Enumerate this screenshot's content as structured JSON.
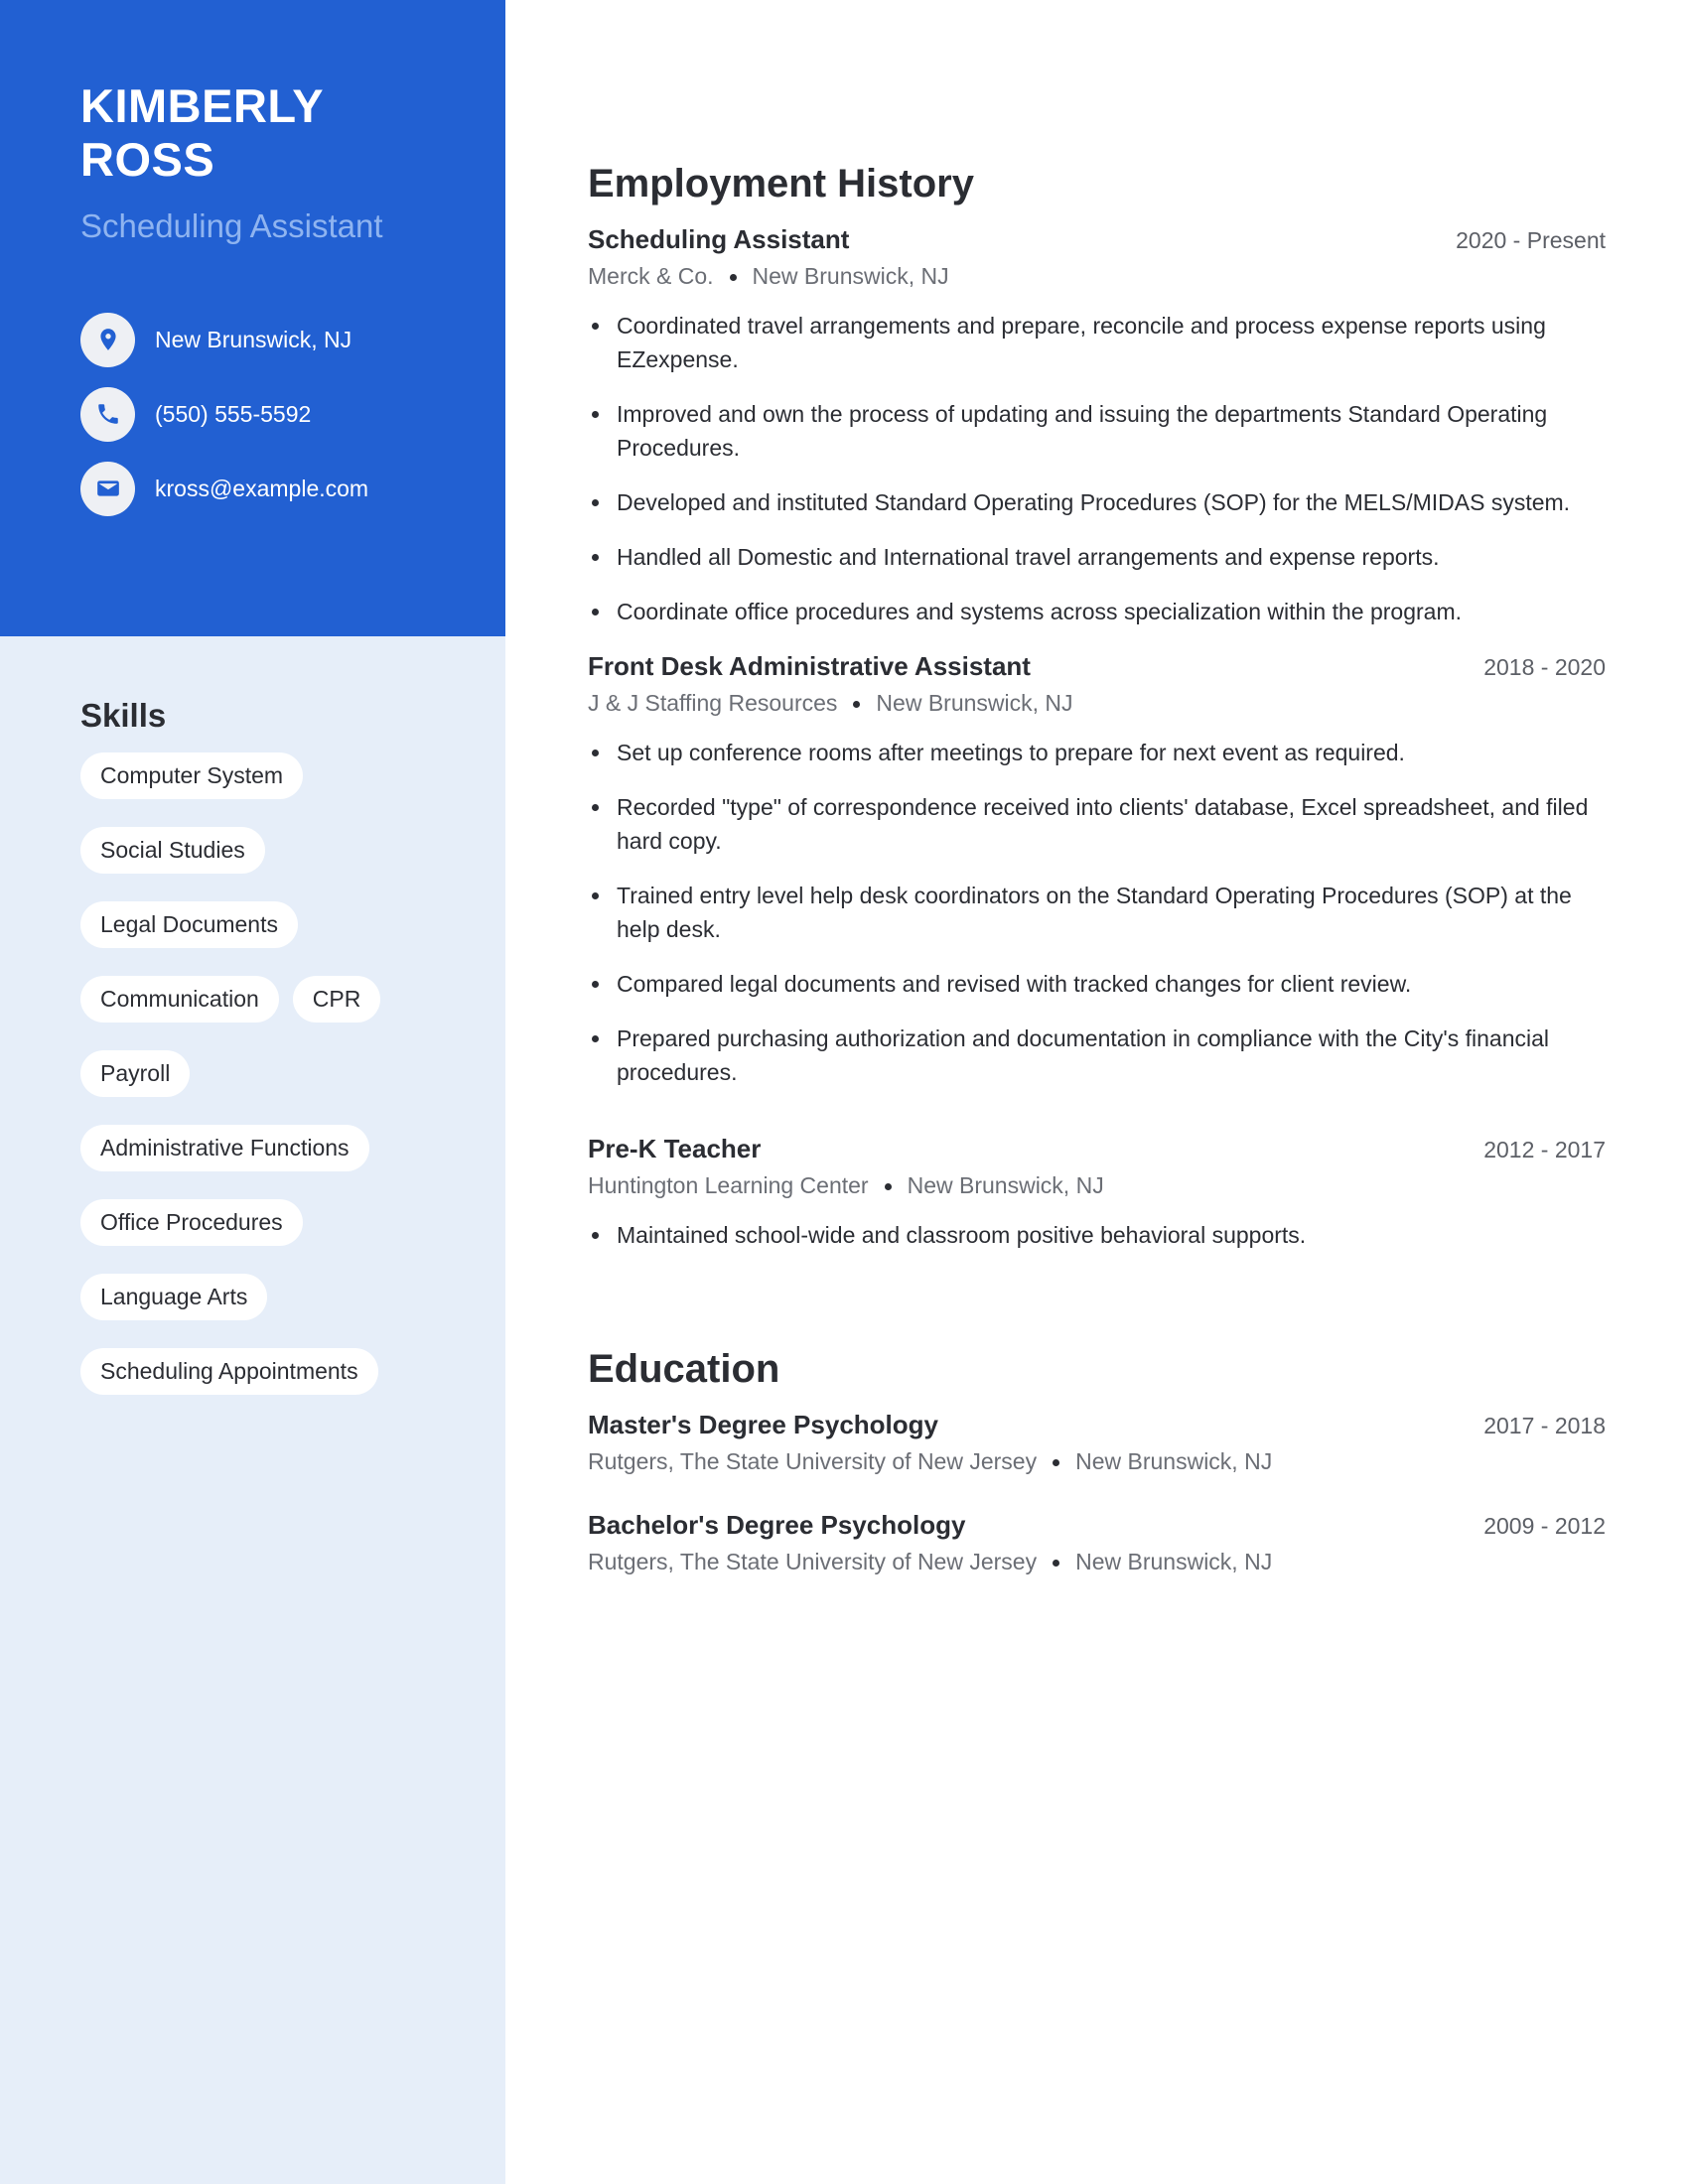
{
  "theme": {
    "accent": "#2260d2",
    "sidebar_bg": "#e6eef9",
    "title_color": "#8fb4f0"
  },
  "header": {
    "name": "KIMBERLY ROSS",
    "title": "Scheduling Assistant"
  },
  "contacts": [
    {
      "icon": "location-pin-icon",
      "text": "New Brunswick, NJ"
    },
    {
      "icon": "phone-icon",
      "text": "(550) 555-5592"
    },
    {
      "icon": "envelope-icon",
      "text": "kross@example.com"
    }
  ],
  "skills": {
    "title": "Skills",
    "items": [
      "Computer System",
      "Social Studies",
      "Legal Documents",
      "Communication",
      "CPR",
      "Payroll",
      "Administrative Functions",
      "Office Procedures",
      "Language Arts",
      "Scheduling Appointments"
    ]
  },
  "employment": {
    "title": "Employment History",
    "jobs": [
      {
        "title": "Scheduling Assistant",
        "dates": "2020 - Present",
        "company": "Merck & Co.",
        "location": "New Brunswick, NJ",
        "bullets": [
          "Coordinated travel arrangements and prepare, reconcile and process expense reports using EZexpense.",
          "Improved and own the process of updating and issuing the departments Standard Operating Procedures.",
          "Developed and instituted Standard Operating Procedures (SOP) for the MELS/MIDAS system.",
          "Handled all Domestic and International travel arrangements and expense reports.",
          "Coordinate office procedures and systems across specialization within the program."
        ]
      },
      {
        "title": "Front Desk Administrative Assistant",
        "dates": "2018 - 2020",
        "company": "J & J Staffing Resources",
        "location": "New Brunswick, NJ",
        "bullets": [
          "Set up conference rooms after meetings to prepare for next event as required.",
          "Recorded \"type\" of correspondence received into clients' database, Excel spreadsheet, and filed hard copy.",
          "Trained entry level help desk coordinators on the Standard Operating Procedures (SOP) at the help desk.",
          "Compared legal documents and revised with tracked changes for client review.",
          "Prepared purchasing authorization and documentation in compliance with the City's financial procedures."
        ]
      },
      {
        "title": "Pre-K Teacher",
        "dates": "2012 - 2017",
        "company": "Huntington Learning Center",
        "location": "New Brunswick, NJ",
        "bullets": [
          "Maintained school-wide and classroom positive behavioral supports."
        ]
      }
    ]
  },
  "education": {
    "title": "Education",
    "entries": [
      {
        "degree": "Master's Degree Psychology",
        "dates": "2017 - 2018",
        "school": "Rutgers, The State University of New Jersey",
        "location": "New Brunswick, NJ"
      },
      {
        "degree": "Bachelor's Degree Psychology",
        "dates": "2009 - 2012",
        "school": "Rutgers, The State University of New Jersey",
        "location": "New Brunswick, NJ"
      }
    ]
  }
}
